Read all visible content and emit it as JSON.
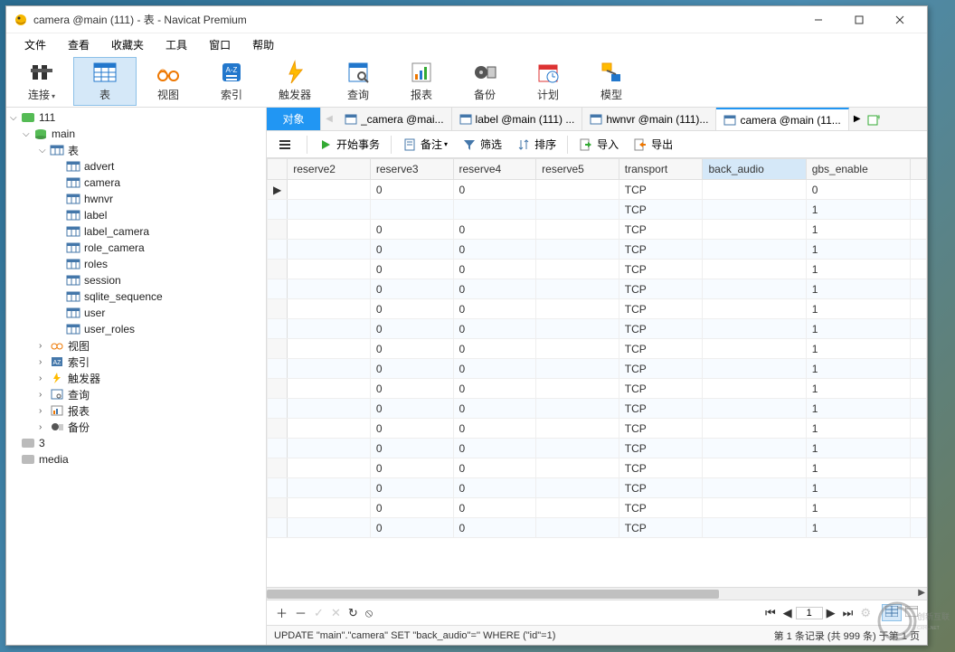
{
  "window": {
    "title": "camera @main (111) - 表 - Navicat Premium"
  },
  "menu": [
    "文件",
    "查看",
    "收藏夹",
    "工具",
    "窗口",
    "帮助"
  ],
  "toolbar": [
    {
      "id": "connect",
      "label": "连接",
      "dd": true
    },
    {
      "id": "table",
      "label": "表",
      "active": true
    },
    {
      "id": "view",
      "label": "视图"
    },
    {
      "id": "index",
      "label": "索引"
    },
    {
      "id": "trigger",
      "label": "触发器"
    },
    {
      "id": "query",
      "label": "查询"
    },
    {
      "id": "report",
      "label": "报表"
    },
    {
      "id": "backup",
      "label": "备份"
    },
    {
      "id": "schedule",
      "label": "计划"
    },
    {
      "id": "model",
      "label": "模型"
    }
  ],
  "tree": [
    {
      "d": 0,
      "arrow": "v",
      "icon": "db-green",
      "label": "111"
    },
    {
      "d": 1,
      "arrow": "v",
      "icon": "db-cyl",
      "label": "main"
    },
    {
      "d": 2,
      "arrow": "v",
      "icon": "tbl",
      "label": "表"
    },
    {
      "d": 3,
      "icon": "tbl",
      "label": "advert"
    },
    {
      "d": 3,
      "icon": "tbl",
      "label": "camera"
    },
    {
      "d": 3,
      "icon": "tbl",
      "label": "hwnvr"
    },
    {
      "d": 3,
      "icon": "tbl",
      "label": "label"
    },
    {
      "d": 3,
      "icon": "tbl",
      "label": "label_camera"
    },
    {
      "d": 3,
      "icon": "tbl",
      "label": "role_camera"
    },
    {
      "d": 3,
      "icon": "tbl",
      "label": "roles"
    },
    {
      "d": 3,
      "icon": "tbl",
      "label": "session"
    },
    {
      "d": 3,
      "icon": "tbl",
      "label": "sqlite_sequence"
    },
    {
      "d": 3,
      "icon": "tbl",
      "label": "user"
    },
    {
      "d": 3,
      "icon": "tbl",
      "label": "user_roles"
    },
    {
      "d": 2,
      "arrow": ">",
      "icon": "view",
      "label": "视图"
    },
    {
      "d": 2,
      "arrow": ">",
      "icon": "idx",
      "label": "索引"
    },
    {
      "d": 2,
      "arrow": ">",
      "icon": "trg",
      "label": "触发器"
    },
    {
      "d": 2,
      "arrow": ">",
      "icon": "qry",
      "label": "查询"
    },
    {
      "d": 2,
      "arrow": ">",
      "icon": "rpt",
      "label": "报表"
    },
    {
      "d": 2,
      "arrow": ">",
      "icon": "bak",
      "label": "备份"
    },
    {
      "d": 0,
      "icon": "db-grey",
      "label": "3"
    },
    {
      "d": 0,
      "icon": "db-grey",
      "label": "media"
    }
  ],
  "tabs": {
    "obj": "对象",
    "items": [
      {
        "label": "_camera @mai..."
      },
      {
        "label": "label @main (111) ..."
      },
      {
        "label": "hwnvr @main (111)..."
      },
      {
        "label": "camera @main (11...",
        "active": true
      }
    ]
  },
  "ribbon": {
    "begin": "开始事务",
    "memo": "备注",
    "filter": "筛选",
    "sort": "排序",
    "import": "导入",
    "export": "导出"
  },
  "columns": [
    "reserve2",
    "reserve3",
    "reserve4",
    "reserve5",
    "transport",
    "back_audio",
    "gbs_enable"
  ],
  "selected_col_index": 5,
  "rows": [
    {
      "reserve2": "",
      "reserve3": "0",
      "reserve4": "0",
      "reserve5": "",
      "transport": "TCP",
      "back_audio": "",
      "gbs_enable": "0"
    },
    {
      "reserve2": "",
      "reserve3": "",
      "reserve4": "",
      "reserve5": "",
      "transport": "TCP",
      "back_audio": "",
      "gbs_enable": "1"
    },
    {
      "reserve2": "",
      "reserve3": "0",
      "reserve4": "0",
      "reserve5": "",
      "transport": "TCP",
      "back_audio": "",
      "gbs_enable": "1"
    },
    {
      "reserve2": "",
      "reserve3": "0",
      "reserve4": "0",
      "reserve5": "",
      "transport": "TCP",
      "back_audio": "",
      "gbs_enable": "1"
    },
    {
      "reserve2": "",
      "reserve3": "0",
      "reserve4": "0",
      "reserve5": "",
      "transport": "TCP",
      "back_audio": "",
      "gbs_enable": "1"
    },
    {
      "reserve2": "",
      "reserve3": "0",
      "reserve4": "0",
      "reserve5": "",
      "transport": "TCP",
      "back_audio": "",
      "gbs_enable": "1"
    },
    {
      "reserve2": "",
      "reserve3": "0",
      "reserve4": "0",
      "reserve5": "",
      "transport": "TCP",
      "back_audio": "",
      "gbs_enable": "1"
    },
    {
      "reserve2": "",
      "reserve3": "0",
      "reserve4": "0",
      "reserve5": "",
      "transport": "TCP",
      "back_audio": "",
      "gbs_enable": "1"
    },
    {
      "reserve2": "",
      "reserve3": "0",
      "reserve4": "0",
      "reserve5": "",
      "transport": "TCP",
      "back_audio": "",
      "gbs_enable": "1"
    },
    {
      "reserve2": "",
      "reserve3": "0",
      "reserve4": "0",
      "reserve5": "",
      "transport": "TCP",
      "back_audio": "",
      "gbs_enable": "1"
    },
    {
      "reserve2": "",
      "reserve3": "0",
      "reserve4": "0",
      "reserve5": "",
      "transport": "TCP",
      "back_audio": "",
      "gbs_enable": "1"
    },
    {
      "reserve2": "",
      "reserve3": "0",
      "reserve4": "0",
      "reserve5": "",
      "transport": "TCP",
      "back_audio": "",
      "gbs_enable": "1"
    },
    {
      "reserve2": "",
      "reserve3": "0",
      "reserve4": "0",
      "reserve5": "",
      "transport": "TCP",
      "back_audio": "",
      "gbs_enable": "1"
    },
    {
      "reserve2": "",
      "reserve3": "0",
      "reserve4": "0",
      "reserve5": "",
      "transport": "TCP",
      "back_audio": "",
      "gbs_enable": "1"
    },
    {
      "reserve2": "",
      "reserve3": "0",
      "reserve4": "0",
      "reserve5": "",
      "transport": "TCP",
      "back_audio": "",
      "gbs_enable": "1"
    },
    {
      "reserve2": "",
      "reserve3": "0",
      "reserve4": "0",
      "reserve5": "",
      "transport": "TCP",
      "back_audio": "",
      "gbs_enable": "1"
    },
    {
      "reserve2": "",
      "reserve3": "0",
      "reserve4": "0",
      "reserve5": "",
      "transport": "TCP",
      "back_audio": "",
      "gbs_enable": "1"
    },
    {
      "reserve2": "",
      "reserve3": "0",
      "reserve4": "0",
      "reserve5": "",
      "transport": "TCP",
      "back_audio": "",
      "gbs_enable": "1"
    }
  ],
  "nav": {
    "page": "1"
  },
  "status": {
    "sql": "UPDATE \"main\".\"camera\" SET \"back_audio\"='' WHERE (\"id\"=1)",
    "pos": "第 1 条记录 (共 999 条) 于第 1 页"
  },
  "watermark": {
    "brand": "创新互联"
  }
}
